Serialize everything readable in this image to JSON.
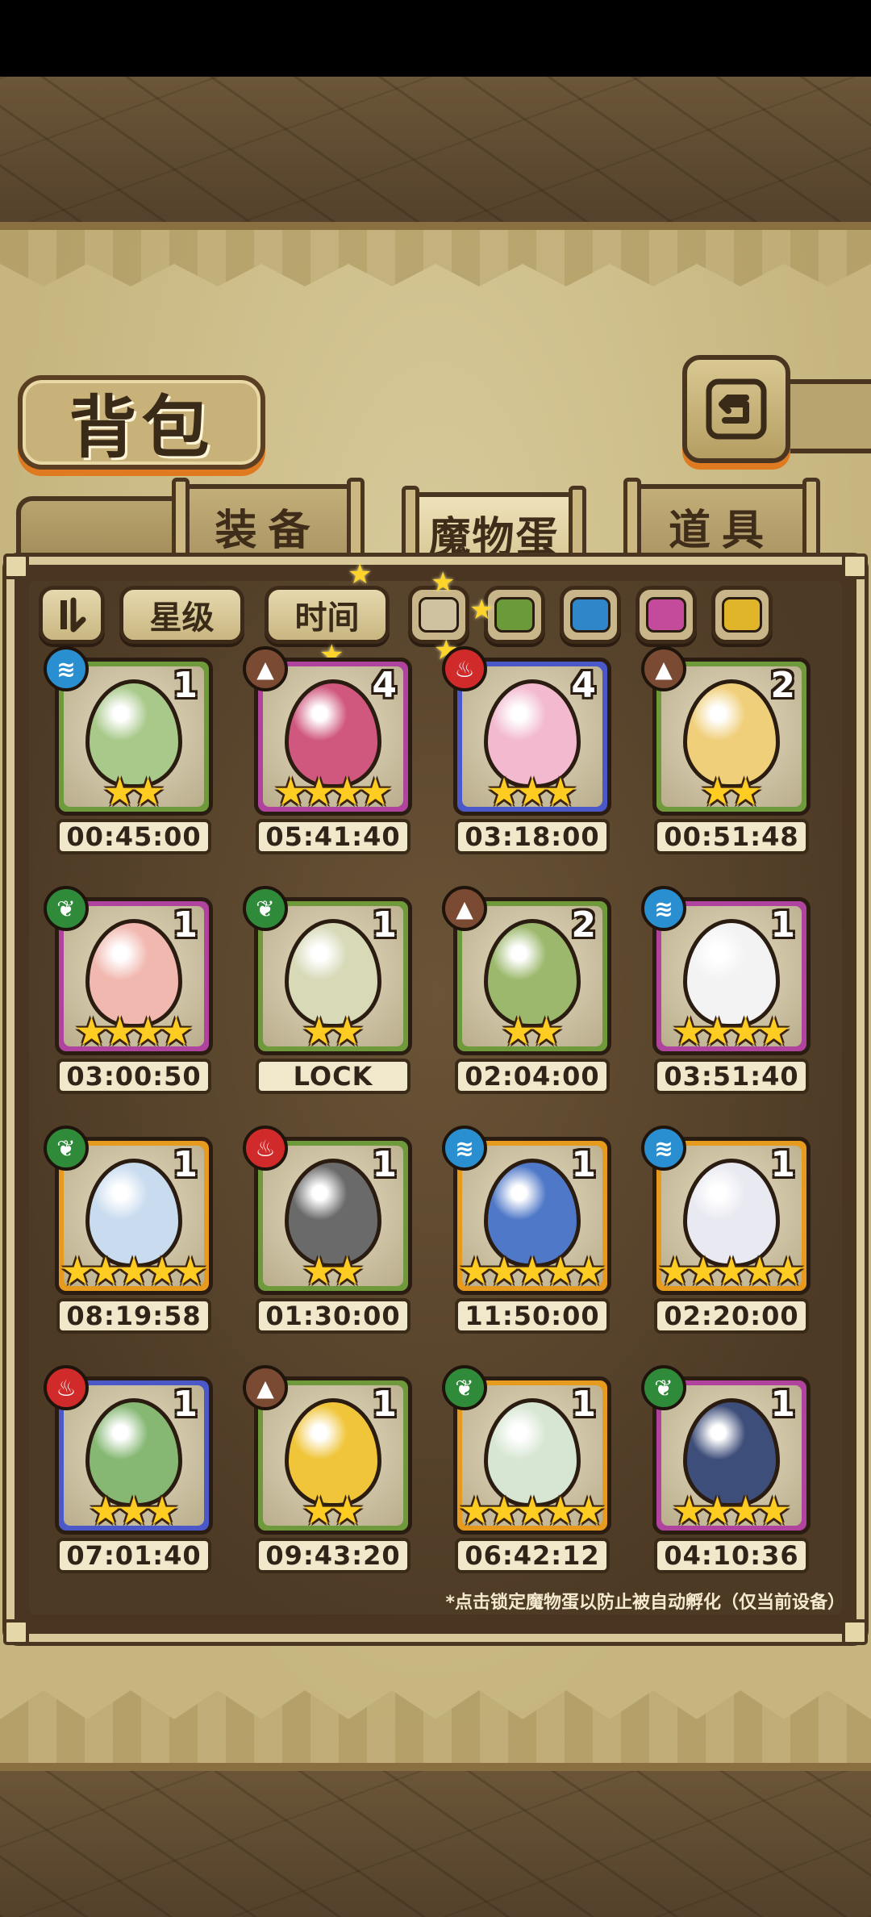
{
  "title": "背包",
  "tabs": [
    {
      "label": "装备"
    },
    {
      "label": "魔物蛋"
    },
    {
      "label": "道具"
    }
  ],
  "filters": {
    "sort_icon": "sort-toggle-icon",
    "star_label": "星级",
    "time_label": "时间",
    "swatches": [
      "#cfc2a1",
      "#6a9a3a",
      "#2f86c9",
      "#c44b9c",
      "#e0b52a"
    ]
  },
  "eggs": [
    {
      "count": "1",
      "stars": 2,
      "timer": "00:45:00",
      "element": "water",
      "frame": "#6f9a3c",
      "color": "#a8c98a"
    },
    {
      "count": "4",
      "stars": 4,
      "timer": "05:41:40",
      "element": "earth",
      "frame": "#b0439e",
      "color": "#d0587e"
    },
    {
      "count": "4",
      "stars": 3,
      "timer": "03:18:00",
      "element": "fire",
      "frame": "#4a58c8",
      "color": "#f2b9cf"
    },
    {
      "count": "2",
      "stars": 2,
      "timer": "00:51:48",
      "element": "earth",
      "frame": "#6f9a3c",
      "color": "#f0cf7a"
    },
    {
      "count": "1",
      "stars": 4,
      "timer": "03:00:50",
      "element": "leaf",
      "frame": "#b0439e",
      "color": "#f1b8b0"
    },
    {
      "count": "1",
      "stars": 2,
      "timer": "LOCK",
      "element": "leaf",
      "frame": "#6f9a3c",
      "color": "#d7d9b7"
    },
    {
      "count": "2",
      "stars": 2,
      "timer": "02:04:00",
      "element": "earth",
      "frame": "#6f9a3c",
      "color": "#9cb86c"
    },
    {
      "count": "1",
      "stars": 4,
      "timer": "03:51:40",
      "element": "water",
      "frame": "#b0439e",
      "color": "#f3f3f3"
    },
    {
      "count": "1",
      "stars": 5,
      "timer": "08:19:58",
      "element": "leaf",
      "frame": "#e69b1e",
      "color": "#c8dbef"
    },
    {
      "count": "1",
      "stars": 2,
      "timer": "01:30:00",
      "element": "fire",
      "frame": "#6f9a3c",
      "color": "#6a6a6a"
    },
    {
      "count": "1",
      "stars": 5,
      "timer": "11:50:00",
      "element": "water",
      "frame": "#e69b1e",
      "color": "#4f78c8"
    },
    {
      "count": "1",
      "stars": 5,
      "timer": "02:20:00",
      "element": "water",
      "frame": "#e69b1e",
      "color": "#e9e9f2"
    },
    {
      "count": "1",
      "stars": 3,
      "timer": "07:01:40",
      "element": "fire",
      "frame": "#4a58c8",
      "color": "#86b874"
    },
    {
      "count": "1",
      "stars": 2,
      "timer": "09:43:20",
      "element": "earth",
      "frame": "#6f9a3c",
      "color": "#f0c53a"
    },
    {
      "count": "1",
      "stars": 5,
      "timer": "06:42:12",
      "element": "leaf",
      "frame": "#e69b1e",
      "color": "#d7e6d2"
    },
    {
      "count": "1",
      "stars": 4,
      "timer": "04:10:36",
      "element": "leaf",
      "frame": "#b0439e",
      "color": "#3e4e7a"
    }
  ],
  "footer_note": "*点击锁定魔物蛋以防止被自动孵化（仅当前设备）"
}
